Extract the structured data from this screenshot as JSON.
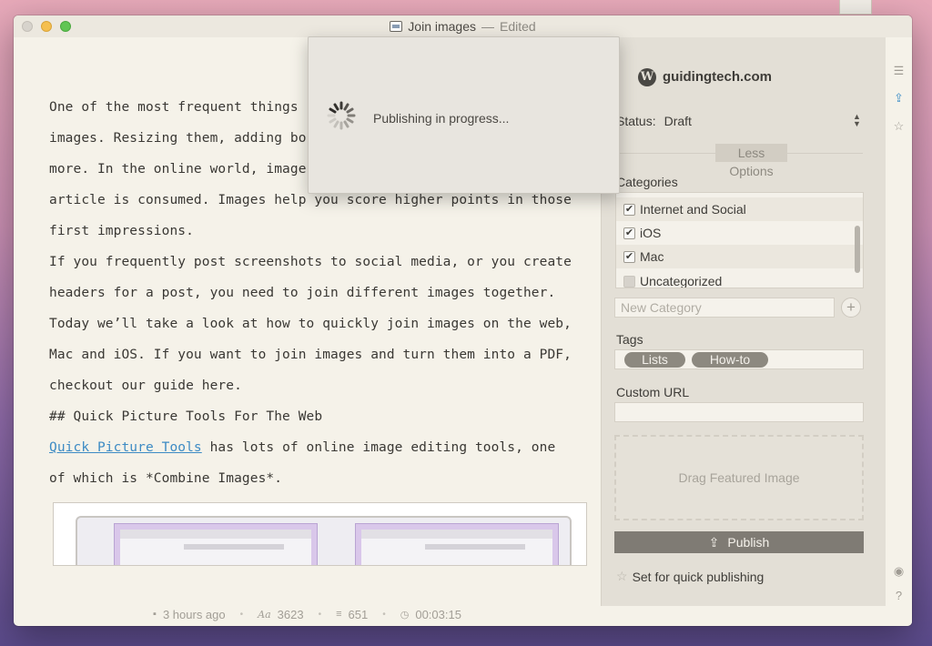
{
  "window": {
    "title": "Join images",
    "separator": "—",
    "status": "Edited"
  },
  "editor": {
    "lines": [
      "One of the most frequent things",
      "images. Resizing them, adding bo",
      "more. In the online world, image",
      "article is consumed. Images help you score higher points in those",
      "first impressions.",
      "If you frequently post screenshots to social media, or you create",
      "headers for a post, you need to join different images together.",
      "Today we’ll take a look at how to quickly join images on the web,",
      "Mac and iOS. If you want to join images and turn them into a PDF,",
      "checkout our guide here.",
      "## Quick Picture Tools For The Web"
    ],
    "link_text": "Quick Picture Tools",
    "link_rest": " has lots of online image editing tools, one",
    "last_line": "of which is *Combine Images*."
  },
  "status_bar": {
    "saved": "3 hours ago",
    "characters": "3623",
    "words": "651",
    "time": "00:03:15"
  },
  "publish_panel": {
    "site": "guidingtech.com",
    "status_label": "Status:",
    "status_value": "Draft",
    "less_options": "Less Options",
    "categories_label": "Categories",
    "categories": [
      {
        "label": "Internet and Social",
        "checked": true
      },
      {
        "label": "iOS",
        "checked": true
      },
      {
        "label": "Mac",
        "checked": true
      },
      {
        "label": "Uncategorized",
        "checked": false
      }
    ],
    "new_category_placeholder": "New Category",
    "tags_label": "Tags",
    "tags": [
      "Lists",
      "How-to"
    ],
    "custom_url_label": "Custom URL",
    "custom_url_value": "",
    "drag_featured": "Drag Featured Image",
    "publish_label": "Publish",
    "quick_publish": "Set for quick publishing"
  },
  "popover": {
    "message": "Publishing in progress..."
  },
  "icons": {
    "rail": [
      "list-icon",
      "share-icon",
      "star-box-icon",
      "eye-icon",
      "help-icon"
    ]
  }
}
